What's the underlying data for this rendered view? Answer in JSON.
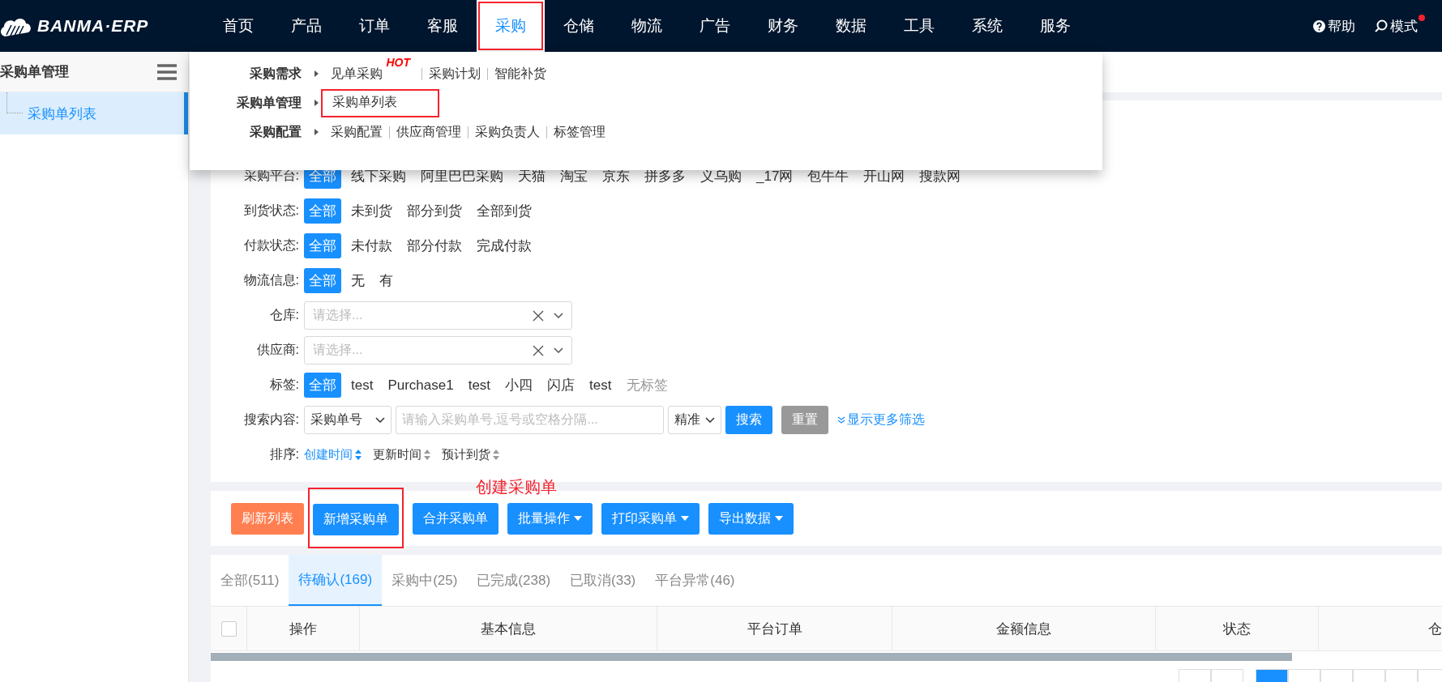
{
  "logo": {
    "text": "BANMA·ERP"
  },
  "nav": {
    "items": [
      {
        "label": "首页",
        "selected": false,
        "highlighted": false
      },
      {
        "label": "产品",
        "selected": false,
        "highlighted": false
      },
      {
        "label": "订单",
        "selected": false,
        "highlighted": false
      },
      {
        "label": "客服",
        "selected": false,
        "highlighted": false
      },
      {
        "label": "采购",
        "selected": true,
        "highlighted": true
      },
      {
        "label": "仓储",
        "selected": false,
        "highlighted": false
      },
      {
        "label": "物流",
        "selected": false,
        "highlighted": false
      },
      {
        "label": "广告",
        "selected": false,
        "highlighted": false
      },
      {
        "label": "财务",
        "selected": false,
        "highlighted": false
      },
      {
        "label": "数据",
        "selected": false,
        "highlighted": false
      },
      {
        "label": "工具",
        "selected": false,
        "highlighted": false
      },
      {
        "label": "系统",
        "selected": false,
        "highlighted": false
      },
      {
        "label": "服务",
        "selected": false,
        "highlighted": false
      }
    ],
    "help": "帮助",
    "mode": {
      "label": "模式",
      "notification": true
    }
  },
  "sidebar": {
    "title": "采购单管理",
    "items": [
      {
        "label": "采购单列表",
        "selected": true
      }
    ]
  },
  "dropdown": {
    "groups": [
      {
        "title": "采购需求",
        "items": [
          {
            "label": "见单采购",
            "badge": "HOT",
            "highlighted": false
          },
          {
            "label": "采购计划",
            "highlighted": false
          },
          {
            "label": "智能补货",
            "highlighted": false
          }
        ]
      },
      {
        "title": "采购单管理",
        "items": [
          {
            "label": "采购单列表",
            "highlighted": true
          }
        ]
      },
      {
        "title": "采购配置",
        "items": [
          {
            "label": "采购配置",
            "highlighted": false
          },
          {
            "label": "供应商管理",
            "highlighted": false
          },
          {
            "label": "采购负责人",
            "highlighted": false
          },
          {
            "label": "标签管理",
            "highlighted": false
          }
        ]
      }
    ]
  },
  "filters": [
    {
      "kind": "chips",
      "label": "采购平台:",
      "options": [
        {
          "label": "全部",
          "selected": true
        },
        {
          "label": "线下采购",
          "selected": false
        },
        {
          "label": "阿里巴巴采购",
          "selected": false
        },
        {
          "label": "天猫",
          "selected": false
        },
        {
          "label": "淘宝",
          "selected": false
        },
        {
          "label": "京东",
          "selected": false
        },
        {
          "label": "拼多多",
          "selected": false
        },
        {
          "label": "义乌购",
          "selected": false
        },
        {
          "label": "_17网",
          "selected": false
        },
        {
          "label": "包牛牛",
          "selected": false
        },
        {
          "label": "开山网",
          "selected": false
        },
        {
          "label": "搜款网",
          "selected": false
        }
      ]
    },
    {
      "kind": "chips",
      "label": "到货状态:",
      "options": [
        {
          "label": "全部",
          "selected": true
        },
        {
          "label": "未到货",
          "selected": false
        },
        {
          "label": "部分到货",
          "selected": false
        },
        {
          "label": "全部到货",
          "selected": false
        }
      ]
    },
    {
      "kind": "chips",
      "label": "付款状态:",
      "options": [
        {
          "label": "全部",
          "selected": true
        },
        {
          "label": "未付款",
          "selected": false
        },
        {
          "label": "部分付款",
          "selected": false
        },
        {
          "label": "完成付款",
          "selected": false
        }
      ]
    },
    {
      "kind": "chips",
      "label": "物流信息:",
      "options": [
        {
          "label": "全部",
          "selected": true
        },
        {
          "label": "无",
          "selected": false
        },
        {
          "label": "有",
          "selected": false
        }
      ]
    },
    {
      "kind": "select",
      "label": "仓库:",
      "placeholder": "请选择..."
    },
    {
      "kind": "select",
      "label": "供应商:",
      "placeholder": "请选择..."
    },
    {
      "kind": "chips",
      "label": "标签:",
      "options": [
        {
          "label": "全部",
          "selected": true,
          "disabled": false
        },
        {
          "label": "test",
          "selected": false,
          "disabled": false
        },
        {
          "label": "Purchase1",
          "selected": false,
          "disabled": false
        },
        {
          "label": "test",
          "selected": false,
          "disabled": false
        },
        {
          "label": "小四",
          "selected": false,
          "disabled": false
        },
        {
          "label": "闪店",
          "selected": false,
          "disabled": false
        },
        {
          "label": "test",
          "selected": false,
          "disabled": false
        },
        {
          "label": "无标签",
          "selected": false,
          "disabled": true
        }
      ]
    },
    {
      "kind": "search",
      "label": "搜索内容:",
      "field": "采购单号",
      "placeholder": "请输入采购单号,逗号或空格分隔...",
      "mode": "精准",
      "search": "搜索",
      "reset": "重置",
      "more": "显示更多筛选"
    },
    {
      "kind": "sort",
      "label": "排序:",
      "options": [
        {
          "label": "创建时间",
          "selected": true
        },
        {
          "label": "更新时间",
          "selected": false
        },
        {
          "label": "预计到货",
          "selected": false
        }
      ]
    }
  ],
  "annotation": "创建采购单",
  "toolbar": [
    {
      "label": "刷新列表",
      "kind": "warn",
      "menu": false,
      "highlighted": false
    },
    {
      "label": "新增采购单",
      "kind": "primary",
      "menu": false,
      "highlighted": true
    },
    {
      "label": "合并采购单",
      "kind": "primary",
      "menu": false,
      "highlighted": false
    },
    {
      "label": "批量操作",
      "kind": "primary",
      "menu": true,
      "highlighted": false
    },
    {
      "label": "打印采购单",
      "kind": "primary",
      "menu": true,
      "highlighted": false
    },
    {
      "label": "导出数据",
      "kind": "primary",
      "menu": true,
      "highlighted": false
    }
  ],
  "tabs": [
    {
      "label": "全部(511)",
      "selected": false
    },
    {
      "label": "待确认(169)",
      "selected": true
    },
    {
      "label": "采购中(25)",
      "selected": false
    },
    {
      "label": "已完成(238)",
      "selected": false
    },
    {
      "label": "已取消(33)",
      "selected": false
    },
    {
      "label": "平台异常(46)",
      "selected": false
    }
  ],
  "table": {
    "select_all": {
      "checked": false
    },
    "columns": [
      "操作",
      "基本信息",
      "平台订单",
      "金额信息",
      "状态",
      "仓"
    ]
  },
  "pager": {
    "pages": [
      {
        "selected": false
      },
      {
        "selected": false
      },
      {
        "selected": true
      },
      {
        "selected": false
      },
      {
        "selected": false
      },
      {
        "selected": false
      },
      {
        "selected": false
      },
      {
        "selected": false
      }
    ]
  }
}
